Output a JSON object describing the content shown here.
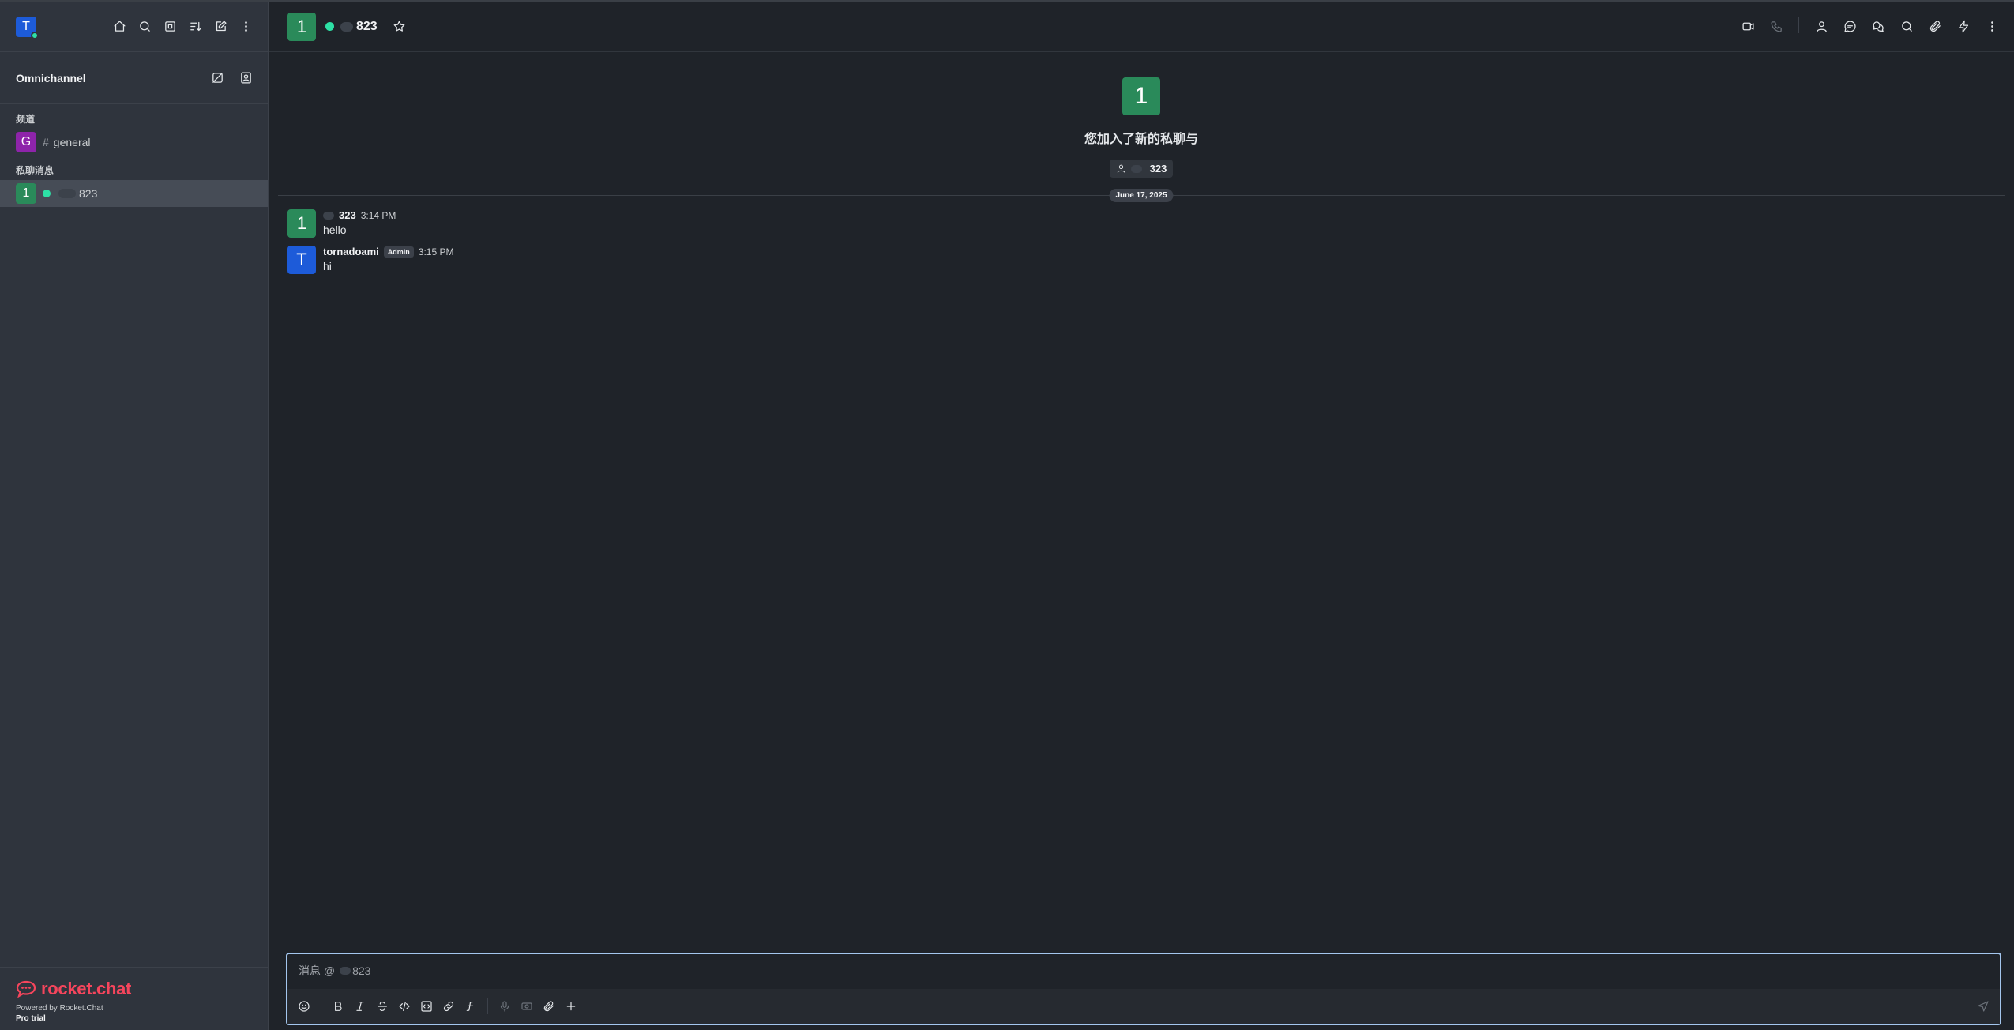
{
  "user": {
    "avatar_letter": "T",
    "status_color": "#2de0a5"
  },
  "sidebar": {
    "section_title": "Omnichannel",
    "groups": [
      {
        "label": "频道",
        "items": [
          {
            "avatar_letter": "G",
            "avatar_color": "#8e24aa",
            "name": "general",
            "type": "channel"
          }
        ]
      },
      {
        "label": "私聊消息",
        "items": [
          {
            "avatar_letter": "1",
            "avatar_color": "#2a8a5a",
            "name": "823",
            "type": "dm",
            "status": "online"
          }
        ]
      }
    ],
    "footer": {
      "logo_text": "rocket.chat",
      "powered_by": "Powered by Rocket.Chat",
      "plan": "Pro trial"
    }
  },
  "room": {
    "avatar_letter": "1",
    "avatar_color": "#2a8a5a",
    "title": "823",
    "intro_text": "您加入了新的私聊与",
    "chip_name": "323",
    "date": "June 17, 2025"
  },
  "messages": [
    {
      "avatar_letter": "1",
      "avatar_color": "#2a8a5a",
      "user": "323",
      "role": "",
      "time": "3:14 PM",
      "text": "hello"
    },
    {
      "avatar_letter": "T",
      "avatar_color": "#1d5bd9",
      "user": "tornadoami",
      "role": "Admin",
      "time": "3:15 PM",
      "text": "hi"
    }
  ],
  "composer": {
    "placeholder": "消息 @",
    "placeholder_target": "823"
  },
  "colors": {
    "accent": "#1d5bd9",
    "online": "#2de0a5",
    "brand": "#f5455c",
    "focus_border": "#a4c6ee"
  }
}
